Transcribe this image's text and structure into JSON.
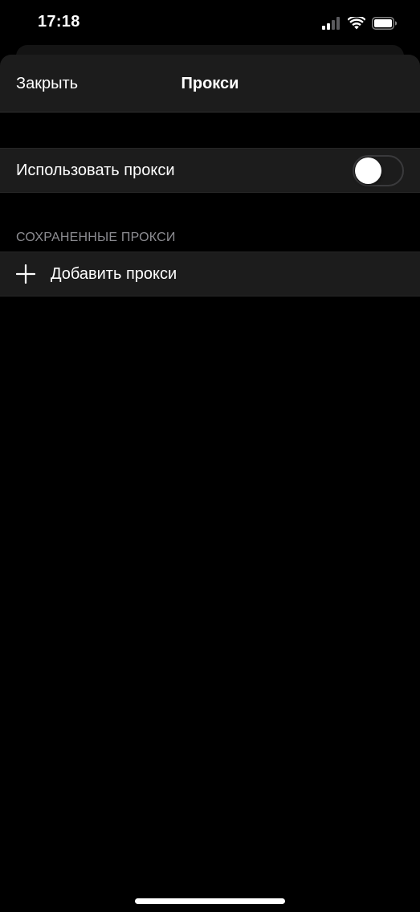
{
  "status_bar": {
    "time": "17:18",
    "icons": [
      "cellular-signal-icon",
      "wifi-icon",
      "battery-icon"
    ]
  },
  "navbar": {
    "close_label": "Закрыть",
    "title": "Прокси"
  },
  "proxy_toggle": {
    "label": "Использовать прокси",
    "enabled": false
  },
  "saved_section": {
    "header": "СОХРАНЕННЫЕ ПРОКСИ",
    "add_label": "Добавить прокси",
    "add_icon": "plus-icon"
  },
  "colors": {
    "background": "#000000",
    "cell_background": "#1c1c1c",
    "section_header_text": "#8d8d92",
    "text": "#ffffff"
  }
}
